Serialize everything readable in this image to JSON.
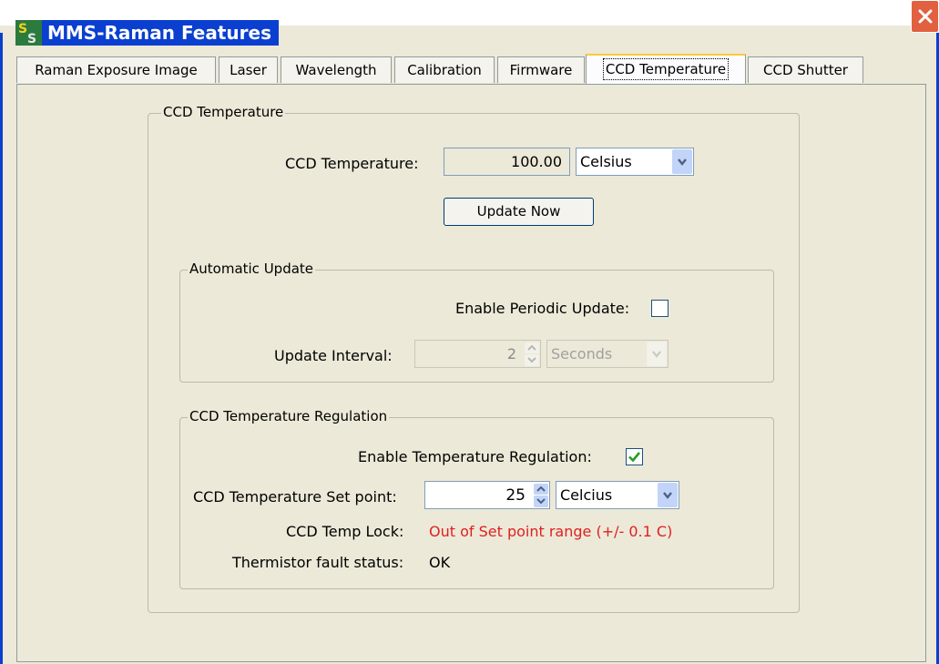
{
  "window": {
    "title": "MMS-Raman Features",
    "icon": "app-logo-icon",
    "close_icon": "close-icon",
    "title_color": "#0A3FD0"
  },
  "tabs": [
    {
      "label": "Raman Exposure Image",
      "active": false
    },
    {
      "label": "Laser",
      "active": false
    },
    {
      "label": "Wavelength",
      "active": false
    },
    {
      "label": "Calibration",
      "active": false
    },
    {
      "label": "Firmware",
      "active": false
    },
    {
      "label": "CCD Temperature",
      "active": true
    },
    {
      "label": "CCD Shutter",
      "active": false
    }
  ],
  "ccd_temperature": {
    "group_title": "CCD Temperature",
    "label": "CCD Temperature:",
    "value": "100.00",
    "unit": "Celsius",
    "update_button": "Update Now"
  },
  "automatic_update": {
    "group_title": "Automatic Update",
    "enable_label": "Enable Periodic Update:",
    "enabled": false,
    "interval_label": "Update Interval:",
    "interval_value": "2",
    "interval_unit": "Seconds"
  },
  "regulation": {
    "group_title": "CCD Temperature Regulation",
    "enable_label": "Enable Temperature Regulation:",
    "enabled": true,
    "setpoint_label": "CCD Temperature Set point:",
    "setpoint_value": "25",
    "setpoint_unit": "Celcius",
    "lock_label": "CCD Temp Lock:",
    "lock_status": "Out of Set point range (+/- 0.1 C)",
    "lock_status_color": "#E02020",
    "thermistor_label": "Thermistor fault status:",
    "thermistor_status": "OK"
  }
}
